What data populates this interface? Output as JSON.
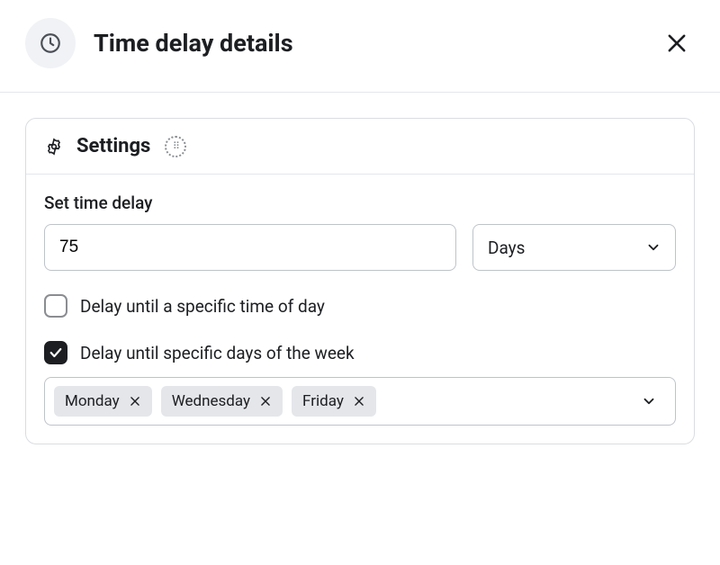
{
  "header": {
    "title": "Time delay details"
  },
  "settings": {
    "title": "Settings",
    "delay_label": "Set time delay",
    "delay_value": "75",
    "unit_value": "Days",
    "time_of_day_checked": false,
    "time_of_day_label": "Delay until a specific time of day",
    "days_of_week_checked": true,
    "days_of_week_label": "Delay until specific days of the week",
    "selected_days": [
      "Monday",
      "Wednesday",
      "Friday"
    ]
  }
}
